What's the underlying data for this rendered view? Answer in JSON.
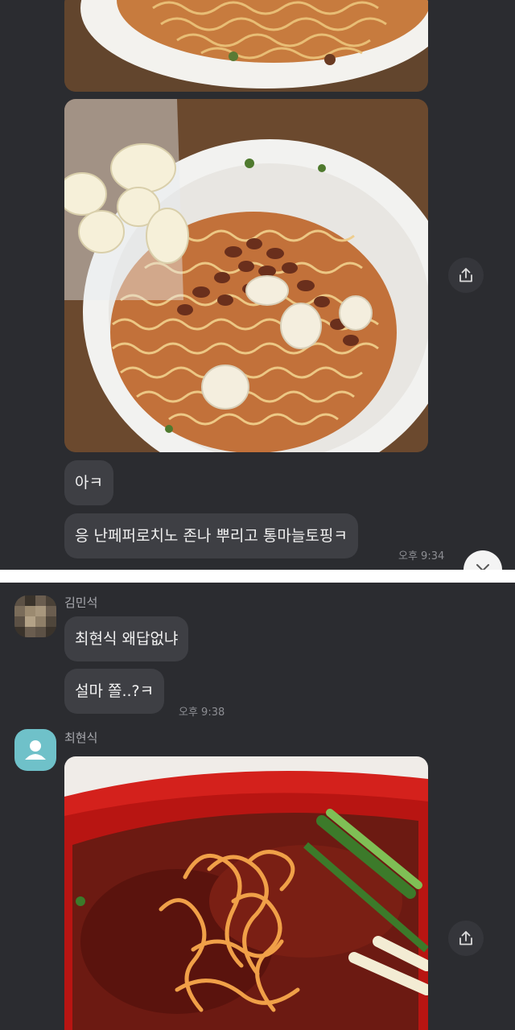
{
  "top_screenshot": {
    "messages": [
      {
        "text": "아ㅋ"
      },
      {
        "text": "응 난페퍼로치노 존나 뿌리고 통마늘토핑ㅋ"
      }
    ],
    "time": "오후 9:34"
  },
  "bottom_screenshot": {
    "participant_1": {
      "name": "김민석",
      "messages": [
        {
          "text": "최현식 왜답없냐"
        },
        {
          "text": "설마 쫄..?ㅋ"
        }
      ],
      "time": "오후 9:38"
    },
    "participant_2": {
      "name": "최현식"
    }
  },
  "icons": {
    "share": "share-icon",
    "scroll_down": "chevron-down-icon",
    "default_avatar": "person-icon"
  },
  "colors": {
    "chat_background": "#2b2c30",
    "bubble": "#3e3f44",
    "avatar_accent": "#6fc1c9"
  }
}
